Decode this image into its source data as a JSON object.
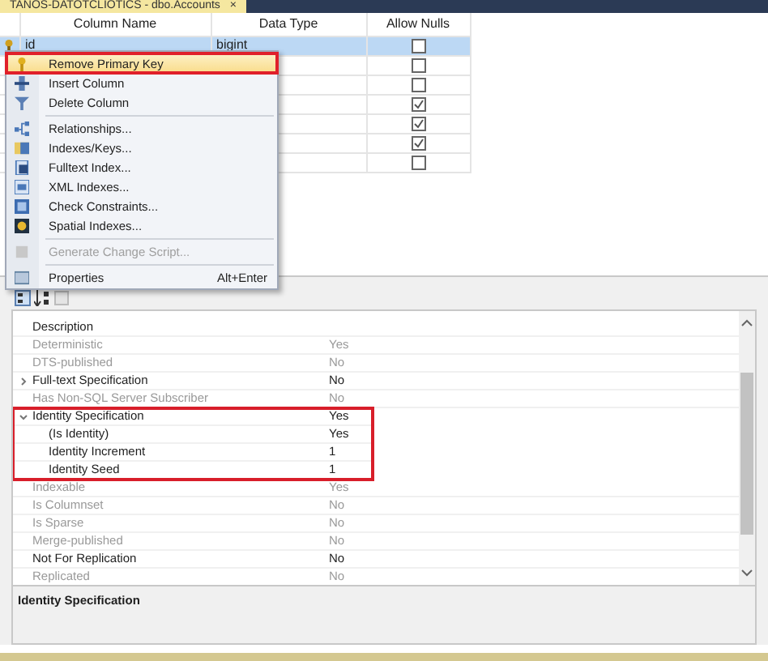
{
  "document_tab": {
    "title": "TANOS-DATOTCLIOTICS - dbo.Accounts",
    "close": "×"
  },
  "table": {
    "columns": [
      "Column Name",
      "Data Type",
      "Allow Nulls"
    ],
    "rows": [
      {
        "name": "id",
        "type": "bigint",
        "allow_nulls": false,
        "primary_key": true,
        "selected": true
      },
      {
        "allow_nulls": false,
        "selected": false
      },
      {
        "allow_nulls": false,
        "selected": false
      },
      {
        "allow_nulls": true,
        "selected": false
      },
      {
        "allow_nulls": true,
        "selected": false
      },
      {
        "allow_nulls": true,
        "selected": false
      },
      {
        "allow_nulls": false,
        "selected": false
      }
    ]
  },
  "context_menu": {
    "items": [
      {
        "kind": "item",
        "label": "Remove Primary Key",
        "selected": true,
        "disabled": false
      },
      {
        "kind": "item",
        "label": "Insert Column",
        "selected": false,
        "disabled": false
      },
      {
        "kind": "item",
        "label": "Delete Column",
        "selected": false,
        "disabled": false
      },
      {
        "kind": "separator"
      },
      {
        "kind": "item",
        "label": "Relationships...",
        "selected": false,
        "disabled": false
      },
      {
        "kind": "item",
        "label": "Indexes/Keys...",
        "selected": false,
        "disabled": false
      },
      {
        "kind": "item",
        "label": "Fulltext Index...",
        "selected": false,
        "disabled": false
      },
      {
        "kind": "item",
        "label": "XML Indexes...",
        "selected": false,
        "disabled": false
      },
      {
        "kind": "item",
        "label": "Check Constraints...",
        "selected": false,
        "disabled": false
      },
      {
        "kind": "item",
        "label": "Spatial Indexes...",
        "selected": false,
        "disabled": false
      },
      {
        "kind": "separator"
      },
      {
        "kind": "item",
        "label": "Generate Change Script...",
        "selected": false,
        "disabled": true
      },
      {
        "kind": "separator"
      },
      {
        "kind": "item",
        "label": "Properties",
        "shortcut": "Alt+Enter",
        "selected": false,
        "disabled": false
      }
    ]
  },
  "properties": {
    "rows": [
      {
        "name": "Description",
        "readonly": false
      },
      {
        "name": "Deterministic",
        "value": "Yes",
        "readonly": true
      },
      {
        "name": "DTS-published",
        "value": "No",
        "readonly": true
      },
      {
        "name": "Full-text Specification",
        "value": "No",
        "readonly": false,
        "expanded": false
      },
      {
        "name": "Has Non-SQL Server Subscriber",
        "value": "No",
        "readonly": true
      },
      {
        "name": "Identity Specification",
        "value": "Yes",
        "readonly": false,
        "expanded": true,
        "highlighted": true,
        "children": [
          {
            "name": "(Is Identity)",
            "value": "Yes",
            "readonly": false
          },
          {
            "name": "Identity Increment",
            "value": "1",
            "readonly": false
          },
          {
            "name": "Identity Seed",
            "value": "1",
            "readonly": false
          }
        ]
      },
      {
        "name": "Indexable",
        "value": "Yes",
        "readonly": true
      },
      {
        "name": "Is Columnset",
        "value": "No",
        "readonly": true
      },
      {
        "name": "Is Sparse",
        "value": "No",
        "readonly": true
      },
      {
        "name": "Merge-published",
        "value": "No",
        "readonly": true
      },
      {
        "name": "Not For Replication",
        "value": "No",
        "readonly": false
      },
      {
        "name": "Replicated",
        "value": "No",
        "readonly": true
      }
    ],
    "description_title": "Identity Specification"
  }
}
